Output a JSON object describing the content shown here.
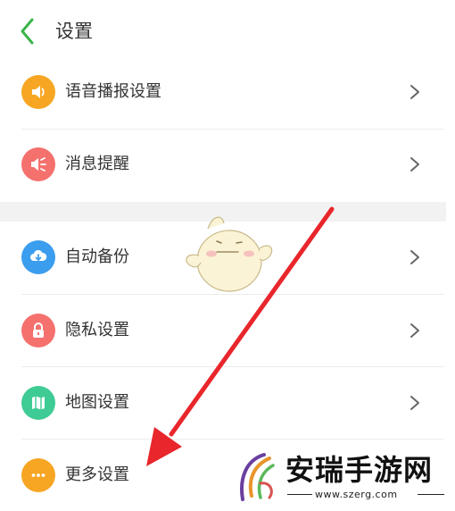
{
  "header": {
    "title": "设置",
    "back_icon": "chevron-left-icon",
    "back_color": "#3cb54a"
  },
  "items": [
    {
      "label": "语音播报设置",
      "icon": "speaker-icon",
      "color": "#f6a623"
    },
    {
      "label": "消息提醒",
      "icon": "notification-speaker-icon",
      "color": "#f4716e"
    },
    {
      "label": "自动备份",
      "icon": "cloud-download-icon",
      "color": "#3b9dee"
    },
    {
      "label": "隐私设置",
      "icon": "lock-icon",
      "color": "#f4716e"
    },
    {
      "label": "地图设置",
      "icon": "map-icon",
      "color": "#3fcb94"
    },
    {
      "label": "更多设置",
      "icon": "more-dots-icon",
      "color": "#f6a623"
    }
  ],
  "annotation": {
    "arrow_color": "#e8262b"
  },
  "watermark": {
    "title": "安瑞手游网",
    "url": "www.szerg.com"
  }
}
